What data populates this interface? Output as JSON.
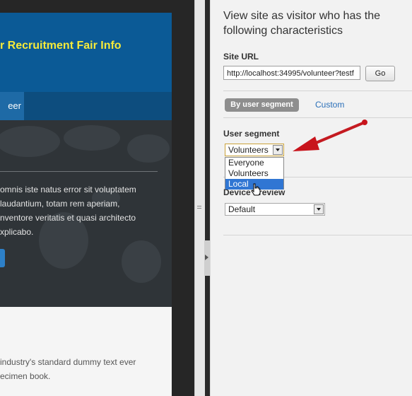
{
  "preview": {
    "site_title": "r Recruitment Fair Info",
    "nav_item": "eer",
    "hero_lines": [
      "omnis iste natus error sit voluptatem",
      " laudantium, totam rem aperiam,",
      "nventore veritatis et quasi architecto",
      "xplicabo."
    ],
    "content_lines": [
      " industry's standard dummy text ever",
      "ecimen book."
    ]
  },
  "panel": {
    "heading": "View site as visitor who has the following characteristics",
    "site_url_label": "Site URL",
    "site_url_value": "http://localhost:34995/volunteer?testf",
    "go_label": "Go",
    "tabs": [
      {
        "label": "By user segment",
        "active": true
      },
      {
        "label": "Custom",
        "active": false
      }
    ],
    "user_segment_label": "User segment",
    "user_segment_selected": "Volunteers",
    "user_segment_options": [
      {
        "label": "Everyone",
        "highlighted": false
      },
      {
        "label": "Volunteers",
        "highlighted": false
      },
      {
        "label": "Local",
        "highlighted": true
      }
    ],
    "device_preview_label": "Device Preview",
    "device_preview_selected": "Default"
  },
  "icons": {
    "dropdown": "chevron-down-icon",
    "cursor": "pointer-hand-icon",
    "annotation": "red-arrow-icon",
    "collapse": "collapse-arrow-icon"
  },
  "colors": {
    "site_header": "#0b5a96",
    "site_title": "#f6ea3a",
    "selected_option": "#3076d3",
    "active_tab": "#8e8e8e",
    "link": "#2a6fb8",
    "annotation_arrow": "#c8141c"
  }
}
